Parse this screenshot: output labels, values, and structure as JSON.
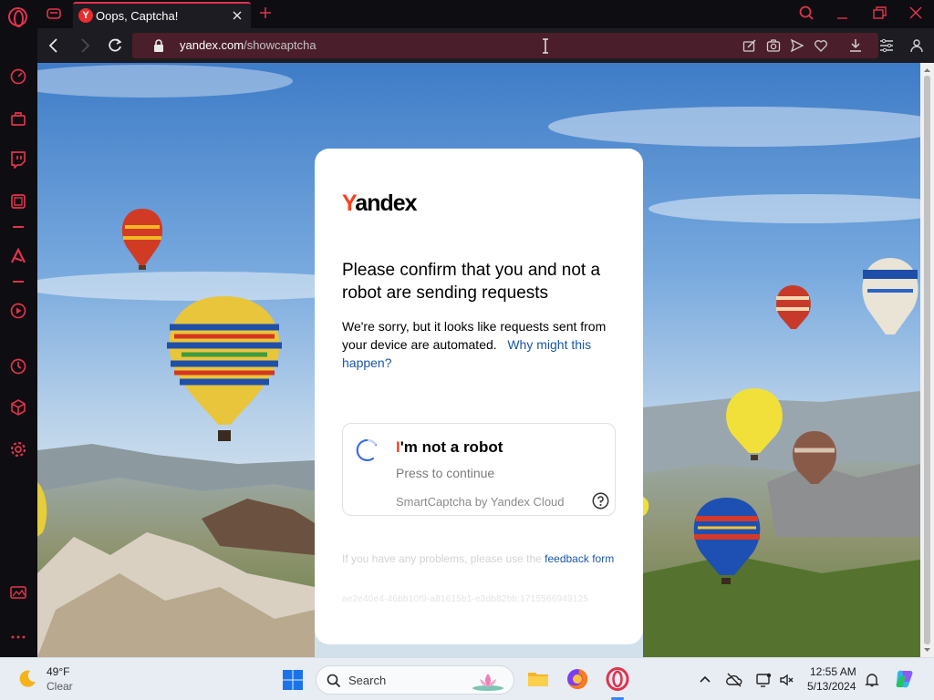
{
  "browser": {
    "tab_title": "Oops, Captcha!",
    "tab_favicon_letter": "Y",
    "url_domain": "yandex.com",
    "url_path": "/showcaptcha",
    "accent_color": "#e0334d"
  },
  "sidebar": {
    "items": [
      "speed-dial-icon",
      "shop-icon",
      "twitch-icon",
      "wallet-icon",
      "aria-icon",
      "player-icon",
      "history-icon",
      "extensions-icon",
      "settings-icon",
      "pinboard-icon",
      "more-icon"
    ]
  },
  "captcha": {
    "logo_first": "Y",
    "logo_rest": "andex",
    "heading": "Please confirm that you and not a robot are sending requests",
    "description": "We're sorry, but it looks like requests sent from your device are automated.",
    "why_link": "Why might this happen?",
    "checkbox_first": "I",
    "checkbox_rest": "'m not a robot",
    "checkbox_sub": "Press to continue",
    "brand": "SmartCaptcha by Yandex Cloud",
    "problem_text": "If you have any problems, please use the",
    "feedback_link": "feedback form",
    "captcha_id": "ae2e40e4-46bb10f9-a81615b1-e3db82bb:1715566949125"
  },
  "taskbar": {
    "weather_temp": "49°F",
    "weather_condition": "Clear",
    "search_placeholder": "Search",
    "clock_time": "12:55 AM",
    "clock_date": "5/13/2024"
  }
}
